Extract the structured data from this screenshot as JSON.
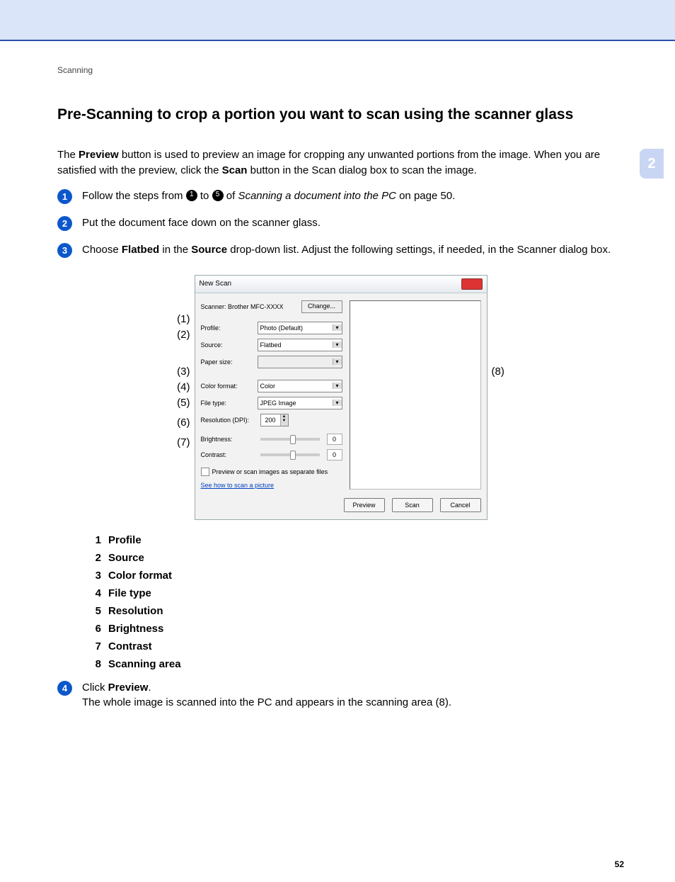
{
  "header": {
    "section": "Scanning"
  },
  "heading": "Pre-Scanning to crop a portion you want to scan using the scanner glass",
  "intro": {
    "p1a": "The ",
    "p1b_bold": "Preview",
    "p1c": " button is used to preview an image for cropping any unwanted portions from the image. When you are satisfied with the preview, click the ",
    "p1d_bold": "Scan",
    "p1e": " button in the Scan dialog box to scan the image."
  },
  "sidetab": "2",
  "steps": {
    "s1": {
      "a": "Follow the steps from ",
      "dark1": "1",
      "b": " to ",
      "dark2": "5",
      "c": " of ",
      "italic": "Scanning a document into the PC",
      "d": " on page 50."
    },
    "s2": "Put the document face down on the scanner glass.",
    "s3": {
      "a": "Choose ",
      "b_bold": "Flatbed",
      "c": " in the ",
      "d_bold": "Source",
      "e": " drop-down list. Adjust the following settings, if needed, in the Scanner dialog box."
    },
    "s4": {
      "a": "Click ",
      "b_bold": "Preview",
      "c": ".",
      "line2": "The whole image is scanned into the PC and appears in the scanning area (8)."
    }
  },
  "dialog": {
    "title": "New Scan",
    "scanner_label": "Scanner: Brother MFC-XXXX",
    "change_btn": "Change...",
    "rows": {
      "profile": {
        "label": "Profile:",
        "value": "Photo (Default)"
      },
      "source": {
        "label": "Source:",
        "value": "Flatbed"
      },
      "paper_size": {
        "label": "Paper size:",
        "value": ""
      },
      "color_format": {
        "label": "Color format:",
        "value": "Color"
      },
      "file_type": {
        "label": "File type:",
        "value": "JPEG Image"
      },
      "resolution": {
        "label": "Resolution (DPI):",
        "value": "200"
      },
      "brightness": {
        "label": "Brightness:",
        "value": "0"
      },
      "contrast": {
        "label": "Contrast:",
        "value": "0"
      }
    },
    "checkbox": "Preview or scan images as separate files",
    "link": "See how to scan a picture",
    "buttons": {
      "preview": "Preview",
      "scan": "Scan",
      "cancel": "Cancel"
    }
  },
  "callouts": {
    "c1": "(1)",
    "c2": "(2)",
    "c3": "(3)",
    "c4": "(4)",
    "c5": "(5)",
    "c6": "(6)",
    "c7": "(7)",
    "c8": "(8)"
  },
  "legend": {
    "i1": {
      "n": "1",
      "t": "Profile"
    },
    "i2": {
      "n": "2",
      "t": "Source"
    },
    "i3": {
      "n": "3",
      "t": "Color format"
    },
    "i4": {
      "n": "4",
      "t": "File type"
    },
    "i5": {
      "n": "5",
      "t": "Resolution"
    },
    "i6": {
      "n": "6",
      "t": "Brightness"
    },
    "i7": {
      "n": "7",
      "t": "Contrast"
    },
    "i8": {
      "n": "8",
      "t": "Scanning area"
    }
  },
  "page_number": "52"
}
